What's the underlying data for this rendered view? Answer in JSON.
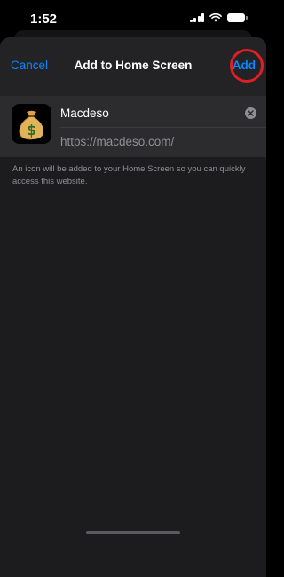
{
  "status_bar": {
    "time": "1:52",
    "icons": [
      "cellular-signal-icon",
      "wifi-icon",
      "battery-icon"
    ]
  },
  "header": {
    "cancel_label": "Cancel",
    "title": "Add to Home Screen",
    "add_label": "Add"
  },
  "bookmark": {
    "name_value": "Macdeso",
    "url": "https://macdeso.com/",
    "icon": "money-bag-icon",
    "clear_icon": "clear-text-icon"
  },
  "description": "An icon will be added to your Home Screen so you can quickly access this website.",
  "colors": {
    "accent": "#0a84ff",
    "sheet_background": "#1c1c1e",
    "card_background": "#2c2c2e",
    "secondary_text": "#8e8e93",
    "highlight": "#e01f25"
  }
}
